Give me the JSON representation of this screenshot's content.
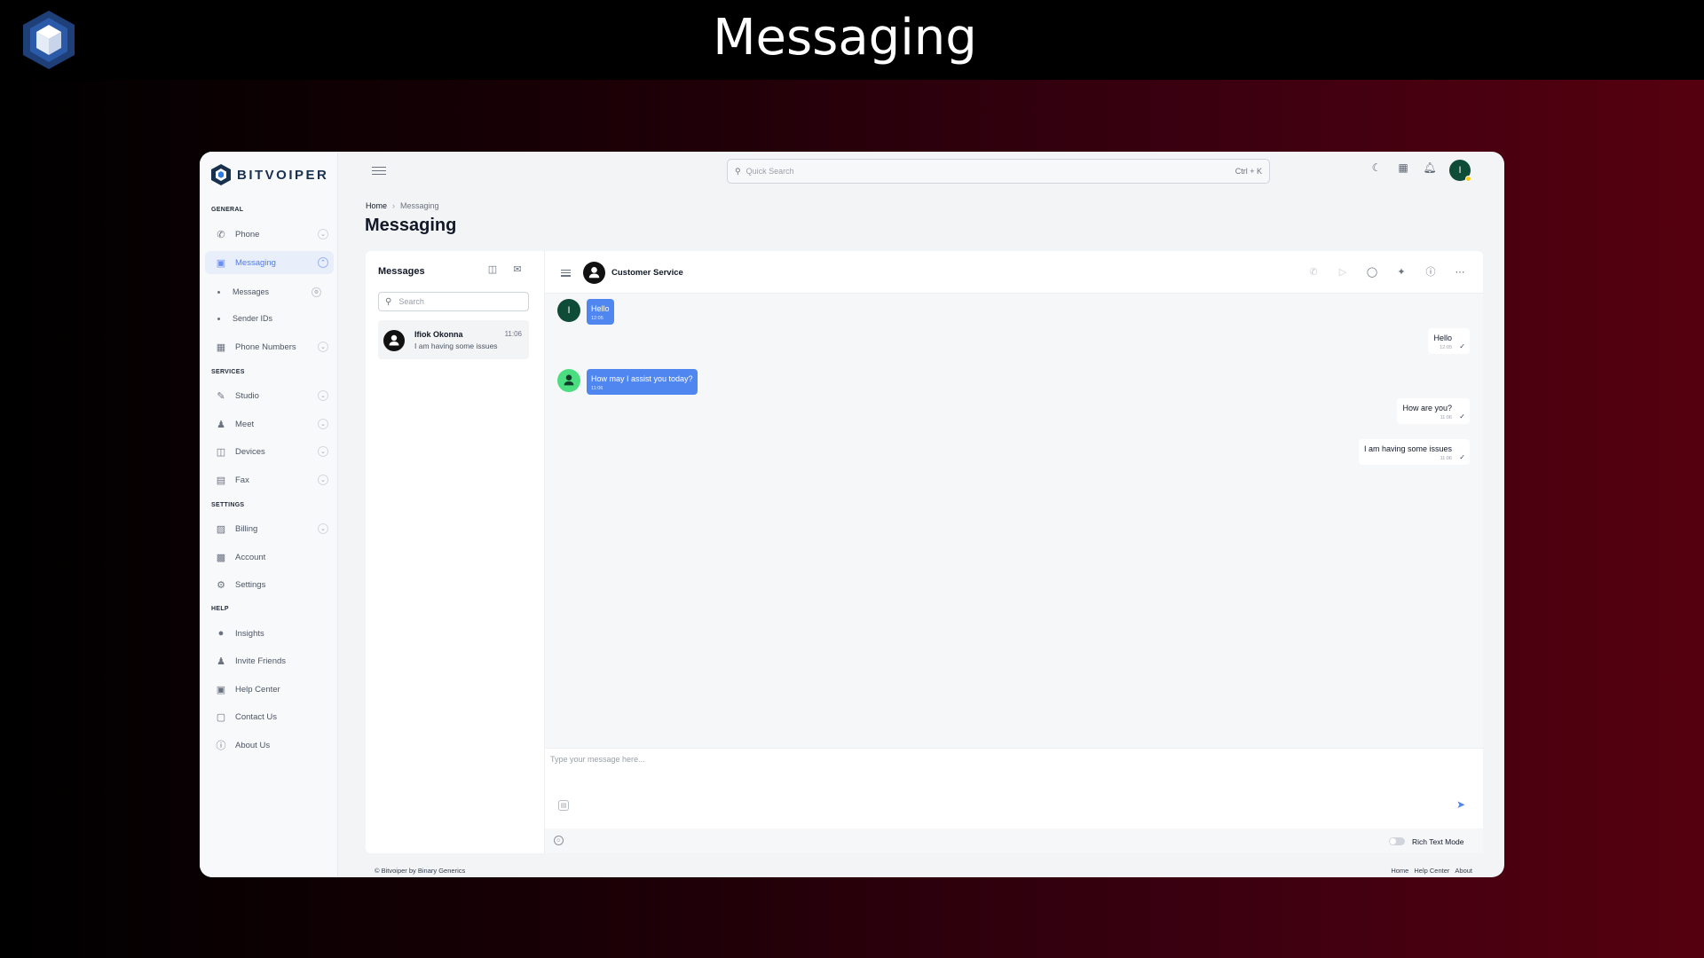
{
  "slide": {
    "title": "Messaging"
  },
  "app": {
    "brand": "BITVOIPER",
    "search": {
      "placeholder": "Quick Search",
      "shortcut": "Ctrl + K"
    },
    "user_initial": "I"
  },
  "sidebar": {
    "sections": {
      "general": "GENERAL",
      "services": "SERVICES",
      "settings": "SETTINGS",
      "help": "HELP"
    },
    "items": {
      "phone": "Phone",
      "messaging": "Messaging",
      "messages": "Messages",
      "sender_ids": "Sender IDs",
      "phone_numbers": "Phone Numbers",
      "studio": "Studio",
      "meet": "Meet",
      "devices": "Devices",
      "fax": "Fax",
      "billing": "Billing",
      "account": "Account",
      "settings": "Settings",
      "insights": "Insights",
      "invite_friends": "Invite Friends",
      "help_center": "Help Center",
      "contact_us": "Contact Us",
      "about_us": "About Us"
    }
  },
  "breadcrumb": {
    "home": "Home",
    "current": "Messaging"
  },
  "page_title": "Messaging",
  "messages_panel": {
    "title": "Messages",
    "search_placeholder": "Search",
    "conversations": [
      {
        "name": "Ifiok Okonna",
        "time": "11:06",
        "preview": "I am having some issues"
      }
    ]
  },
  "chat": {
    "contact": "Customer Service",
    "incoming_avatar_initial": "I",
    "messages": [
      {
        "dir": "in",
        "text": "Hello",
        "time": "12:05"
      },
      {
        "dir": "out",
        "text": "Hello",
        "time": "12:05"
      },
      {
        "dir": "in",
        "text": "How may I assist you today?",
        "time": "11:06"
      },
      {
        "dir": "out",
        "text": "How are you?",
        "time": "11:06"
      },
      {
        "dir": "out",
        "text": "I am having some issues",
        "time": "11:06"
      }
    ],
    "composer_placeholder": "Type your message here...",
    "rich_text_label": "Rich Text Mode",
    "rich_text_enabled": false
  },
  "footer": {
    "copyright": "© Bitvoiper by Binary Generics",
    "links": [
      "Home",
      "Help Center",
      "About"
    ]
  },
  "colors": {
    "accent": "#4f86f0",
    "brand_navy": "#18314f",
    "avatar_green": "#0f4c37",
    "bot_green": "#4ade80"
  }
}
